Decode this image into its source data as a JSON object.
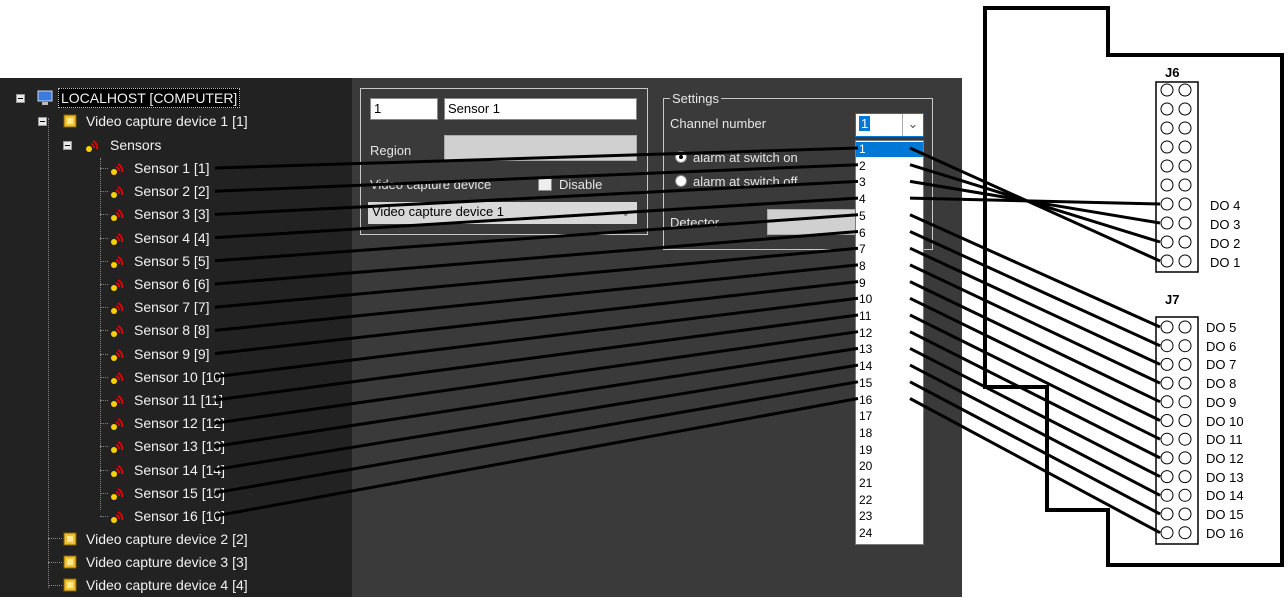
{
  "tree": {
    "root": {
      "label": "LOCALHOST [COMPUTER]"
    },
    "device1": {
      "label": "Video capture device 1 [1]"
    },
    "sensors_group": {
      "label": "Sensors"
    },
    "sensors": [
      "Sensor 1 [1]",
      "Sensor 2 [2]",
      "Sensor 3 [3]",
      "Sensor 4 [4]",
      "Sensor 5 [5]",
      "Sensor 6 [6]",
      "Sensor 7 [7]",
      "Sensor 8 [8]",
      "Sensor 9 [9]",
      "Sensor 10 [10]",
      "Sensor 11 [11]",
      "Sensor 12 [12]",
      "Sensor 13 [13]",
      "Sensor 14 [14]",
      "Sensor 15 [15]",
      "Sensor 16 [16]"
    ],
    "other_devices": [
      "Video capture device 2 [2]",
      "Video capture device 3 [3]",
      "Video capture device 4 [4]"
    ]
  },
  "form": {
    "id_value": "1",
    "name_value": "Sensor 1",
    "region_label": "Region",
    "video_device_label": "Video capture device",
    "disable_label": "Disable",
    "video_device_value": "Video capture device 1",
    "settings_title": "Settings",
    "channel_label": "Channel number",
    "channel_value": "1",
    "radio_on_label": "alarm at switch on",
    "radio_off_label": "alarm at switch off",
    "detector_label": "Detector"
  },
  "dropdown": {
    "options": [
      "1",
      "2",
      "3",
      "4",
      "5",
      "6",
      "7",
      "8",
      "9",
      "10",
      "11",
      "12",
      "13",
      "14",
      "15",
      "16",
      "17",
      "18",
      "19",
      "20",
      "21",
      "22",
      "23",
      "24"
    ],
    "selected": "1"
  },
  "connectors": {
    "j6_label": "J6",
    "j7_label": "J7",
    "j6_pins": [
      "DO 4",
      "DO 3",
      "DO 2",
      "DO 1"
    ],
    "j7_pins": [
      "DO 5",
      "DO 6",
      "DO 7",
      "DO 8",
      "DO 9",
      "DO 10",
      "DO 11",
      "DO 12",
      "DO 13",
      "DO 14",
      "DO 15",
      "DO 16"
    ]
  },
  "colors": {
    "tree_bg": "#222222",
    "panel_bg": "#3a3a3a",
    "selection": "#0078d7"
  }
}
